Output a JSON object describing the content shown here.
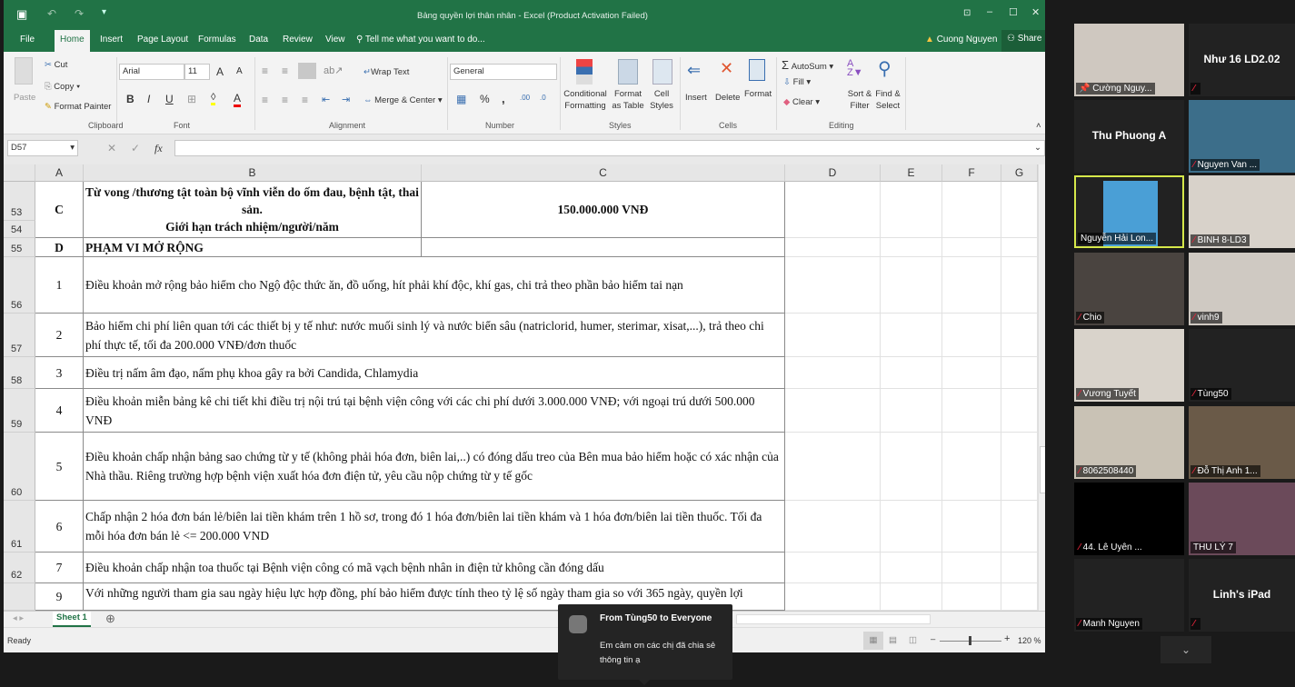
{
  "excel": {
    "title": "Bảng quyền lợi thân nhân - Excel (Product Activation Failed)",
    "tabs": [
      "File",
      "Home",
      "Insert",
      "Page Layout",
      "Formulas",
      "Data",
      "Review",
      "View"
    ],
    "tell_me": "Tell me what you want to do...",
    "user": "Cuong Nguyen",
    "share": "Share",
    "ribbon": {
      "paste": "Paste",
      "cut": "Cut",
      "copy": "Copy",
      "format_painter": "Format Painter",
      "font_name": "Arial",
      "font_size": "11",
      "wrap_text": "Wrap Text",
      "merge_center": "Merge & Center",
      "number_format": "General",
      "conditional_formatting": "Conditional Formatting",
      "format_as_table": "Format as Table",
      "cell_styles": "Cell Styles",
      "insert": "Insert",
      "delete": "Delete",
      "format": "Format",
      "autosum": "AutoSum",
      "fill": "Fill",
      "clear": "Clear",
      "sort_filter": "Sort & Filter",
      "find_select": "Find & Select",
      "groups": [
        "Clipboard",
        "Font",
        "Alignment",
        "Number",
        "Styles",
        "Cells",
        "Editing"
      ]
    },
    "name_box": "D57",
    "columns": [
      "A",
      "B",
      "C",
      "D",
      "E",
      "F",
      "G"
    ],
    "rows": [
      {
        "num": "53",
        "num2": "54",
        "a": "C",
        "b": "Từ vong /thương tật toàn bộ vĩnh viễn do ốm đau, bệnh tật, thai sản.\nGiới hạn trách nhiệm/người/năm",
        "c": "150.000.000 VNĐ"
      },
      {
        "num": "55",
        "a": "D",
        "b": "PHẠM VI MỞ RỘNG",
        "c": ""
      },
      {
        "num": "56",
        "a": "1",
        "b": "Điều khoản mở rộng bảo hiểm cho Ngộ độc thức ăn, đồ uống, hít phải khí độc, khí gas, chi trả theo phần bảo hiểm tai nạn"
      },
      {
        "num": "57",
        "a": "2",
        "b": "Bảo hiểm chi phí liên quan tới các thiết bị y tế như: nước muối sinh lý và nước biển sâu (natriclorid, humer, sterimar, xisat,...), trả theo chi phí thực tế, tối đa 200.000 VNĐ/đơn thuốc"
      },
      {
        "num": "58",
        "a": "3",
        "b": "Điều trị nấm âm đạo, nấm phụ khoa gây ra bởi Candida, Chlamydia"
      },
      {
        "num": "59",
        "a": "4",
        "b": "Điều khoản miễn bảng kê chi tiết khi điều trị nội trú tại bệnh viện công với các chi phí dưới 3.000.000 VNĐ; với ngoại trú dưới 500.000 VNĐ"
      },
      {
        "num": "60",
        "a": "5",
        "b": "Điều khoản chấp nhận bảng sao chứng từ y tế (không phải hóa đơn, biên lai,..) có đóng dấu treo của Bên mua bảo hiểm hoặc có xác nhận của Nhà thầu. Riêng trường hợp bệnh viện xuất hóa đơn điện tử, yêu cầu nộp chứng từ y tế gốc"
      },
      {
        "num": "61",
        "a": "6",
        "b": "Chấp nhận 2 hóa đơn bán lẻ/biên lai tiền khám trên 1 hồ sơ, trong đó 1 hóa đơn/biên lai tiền khám và 1 hóa đơn/biên lai tiền thuốc. Tối đa mỗi hóa đơn bán lẻ <= 200.000 VND"
      },
      {
        "num": "62",
        "a": "7",
        "b": "Điều khoản chấp nhận toa thuốc tại Bệnh viện công có mã vạch bệnh nhân in điện tử không cần đóng dấu"
      },
      {
        "num": "",
        "a": "9",
        "b": "Với những người tham gia sau ngày hiệu lực hợp đồng, phí bảo hiểm được tính theo tỷ lệ số ngày tham gia so với 365 ngày, quyền lợi"
      }
    ],
    "sheet_tab": "Sheet 1",
    "status": "Ready",
    "zoom": "120 %",
    "zoom_percent": 120,
    "accent": "#217346"
  },
  "meeting": {
    "participants": [
      {
        "name": "Cường Nguy...",
        "video": true,
        "pinned": true
      },
      {
        "name": "Như 16 LD2.02",
        "video": false,
        "muted": true
      },
      {
        "name": "Thu Phuong A",
        "video": false,
        "muted": false
      },
      {
        "name": "Nguyen Van ...",
        "video": true,
        "muted": true
      },
      {
        "name": "Nguyễn Hải Lon...",
        "video": true,
        "speaking": true
      },
      {
        "name": "BINH 8-LD3",
        "video": true,
        "muted": true
      },
      {
        "name": "Chio",
        "video": true,
        "muted": true
      },
      {
        "name": "vinh9",
        "video": true,
        "muted": true
      },
      {
        "name": "Vương Tuyết",
        "video": true,
        "muted": true
      },
      {
        "name": "Tùng50",
        "video": true,
        "muted": true
      },
      {
        "name": "8062508440",
        "video": true,
        "muted": true
      },
      {
        "name": "Đỗ Thị Anh 1...",
        "video": true,
        "muted": true
      },
      {
        "name": "44. Lê Uyên ...",
        "video": true,
        "muted": true
      },
      {
        "name": "THU LÝ 7",
        "video": true,
        "muted": false
      },
      {
        "name": "Manh Nguyen",
        "video": true,
        "muted": true
      },
      {
        "name": "Linh's iPad",
        "video": false,
        "muted": true
      }
    ],
    "chat": {
      "from": "From Tùng50 to Everyone",
      "message": "Em cảm ơn các chị đã chia sẻ thông tin ạ"
    }
  }
}
